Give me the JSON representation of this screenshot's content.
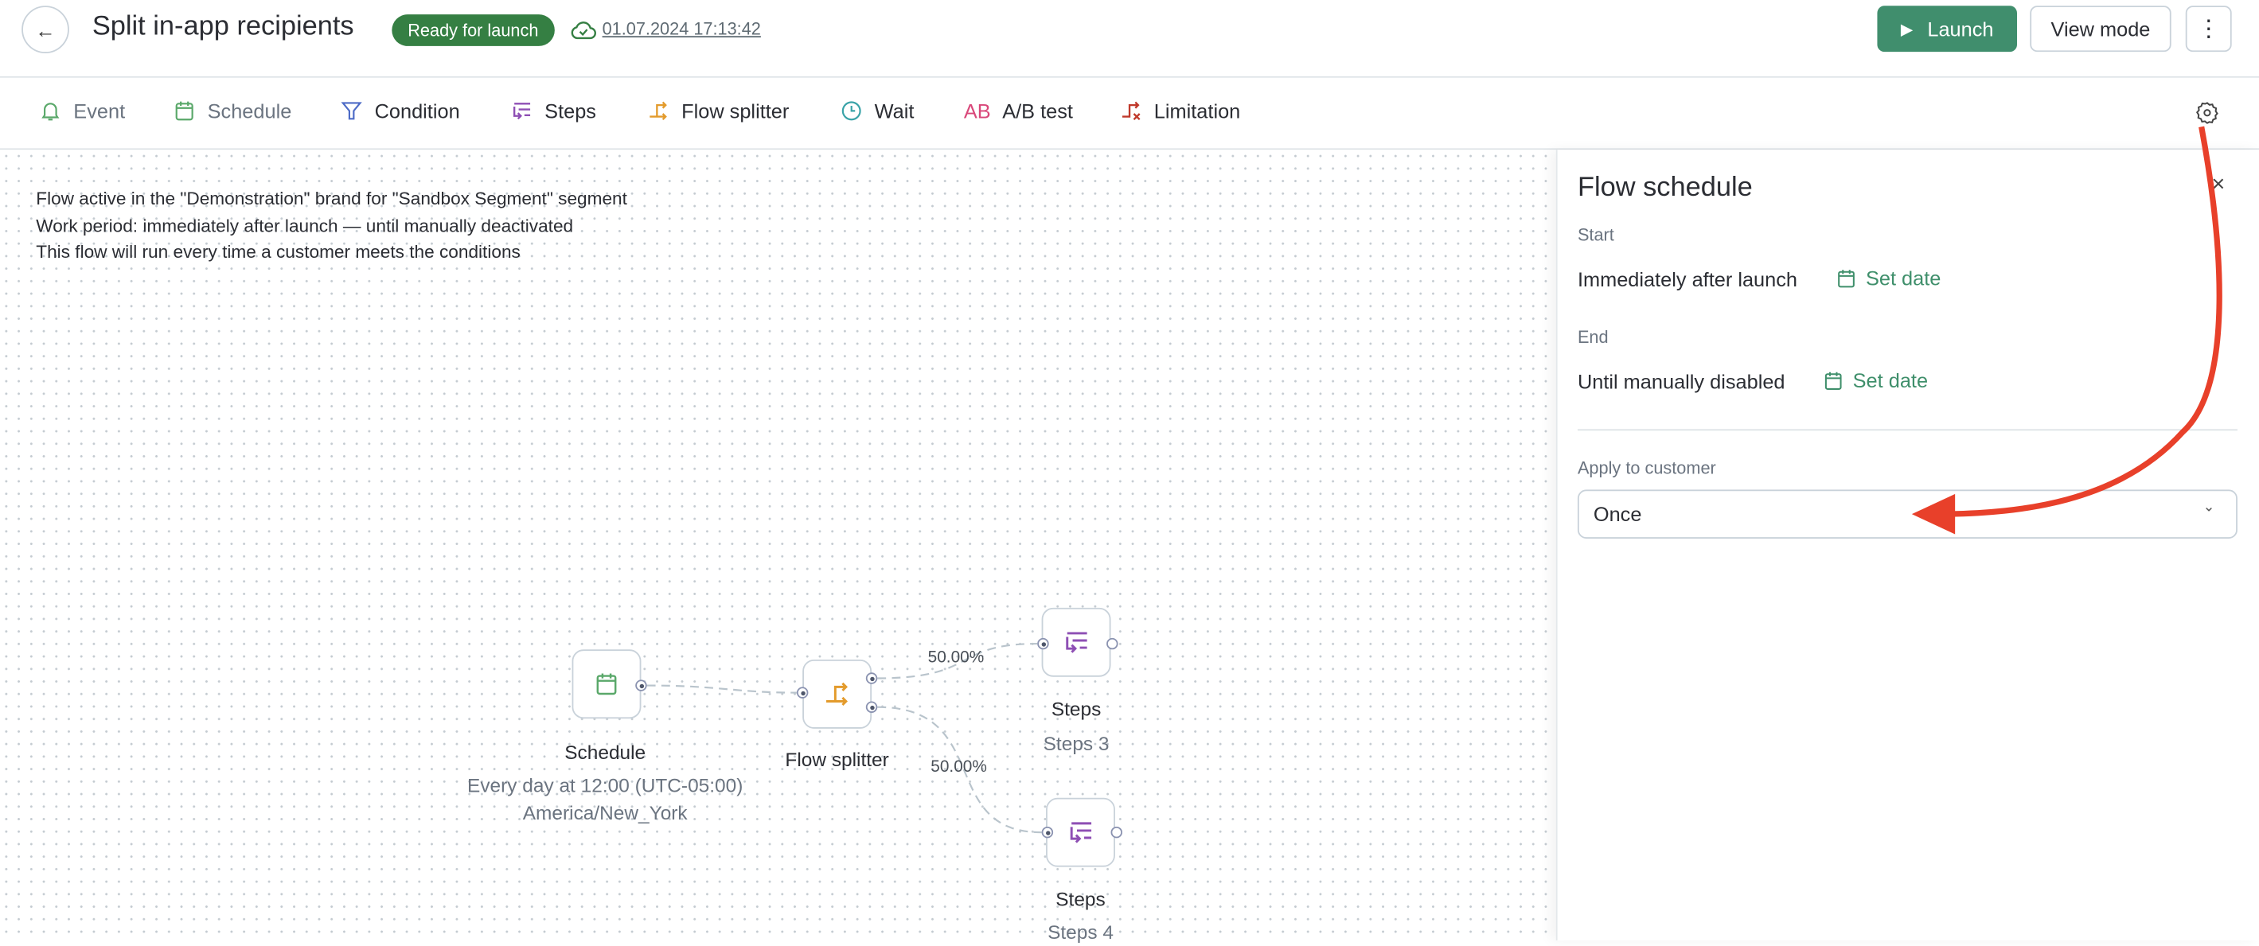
{
  "header": {
    "title": "Split in-app recipients",
    "status_badge": "Ready for launch",
    "saved_at": "01.07.2024 17:13:42",
    "launch_label": "Launch",
    "view_mode_label": "View mode"
  },
  "toolbar": {
    "items": [
      {
        "label": "Event",
        "icon": "bell-icon",
        "color": "#5aa86a"
      },
      {
        "label": "Schedule",
        "icon": "calendar-icon",
        "color": "#5aa86a"
      },
      {
        "label": "Condition",
        "icon": "filter-icon",
        "color": "#4d6bc6"
      },
      {
        "label": "Steps",
        "icon": "steps-icon",
        "color": "#8e4fb4"
      },
      {
        "label": "Flow splitter",
        "icon": "split-icon",
        "color": "#e39b2c"
      },
      {
        "label": "Wait",
        "icon": "clock-icon",
        "color": "#3aa3a8"
      },
      {
        "label": "A/B test",
        "icon": "ab-icon",
        "color": "#d9487a"
      },
      {
        "label": "Limitation",
        "icon": "limit-icon",
        "color": "#c0392b"
      }
    ]
  },
  "canvas": {
    "info": [
      "Flow active in the \"Demonstration\" brand for \"Sandbox Segment\" segment",
      "Work period: immediately after launch — until manually deactivated",
      "This flow will run every time a customer meets the conditions"
    ],
    "nodes": {
      "schedule": {
        "title": "Schedule",
        "sub1": "Every day at 12:00 (UTC-05:00)",
        "sub2": "America/New_York"
      },
      "splitter": {
        "title": "Flow splitter"
      },
      "steps3": {
        "title": "Steps",
        "sub": "Steps 3"
      },
      "steps4": {
        "title": "Steps",
        "sub": "Steps 4"
      }
    },
    "split_top": "50.00%",
    "split_bottom": "50.00%"
  },
  "panel": {
    "title": "Flow schedule",
    "start_label": "Start",
    "start_value": "Immediately after launch",
    "end_label": "End",
    "end_value": "Until manually disabled",
    "set_date": "Set date",
    "apply_label": "Apply to customer",
    "apply_value": "Once"
  },
  "colors": {
    "accent": "#408e6d",
    "badge": "#357f43",
    "annotation_arrow": "#e8402a"
  }
}
